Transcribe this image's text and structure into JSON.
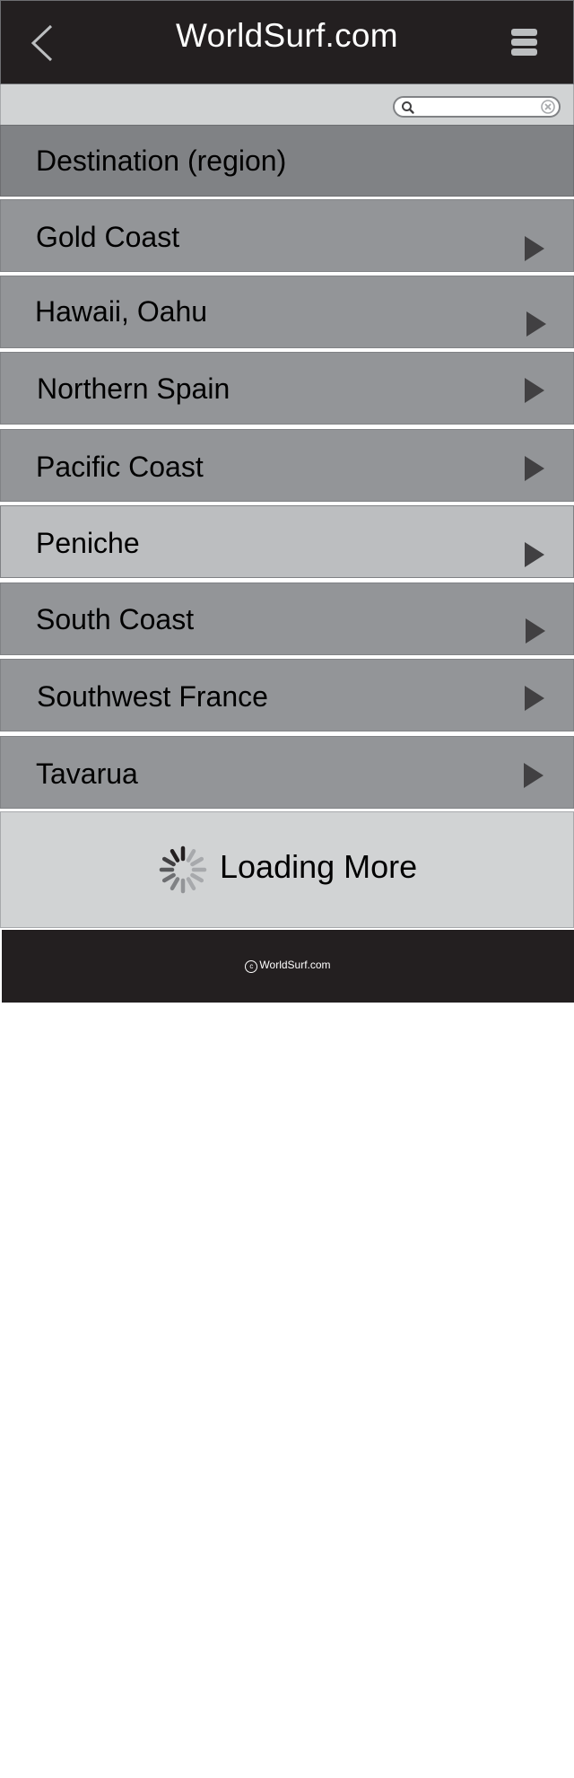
{
  "header": {
    "title": "WorldSurf.com",
    "back_icon": "chevron-left-icon",
    "menu_icon": "hamburger-menu-icon"
  },
  "search": {
    "value": "",
    "placeholder": "",
    "search_icon": "search-icon",
    "clear_icon": "clear-icon"
  },
  "list": {
    "header": "Destination (region)",
    "items": [
      {
        "label": "Gold Coast"
      },
      {
        "label": "Hawaii, Oahu"
      },
      {
        "label": "Northern Spain"
      },
      {
        "label": "Pacific Coast"
      },
      {
        "label": "Peniche",
        "selected": true
      },
      {
        "label": "South Coast"
      },
      {
        "label": "Southwest France"
      },
      {
        "label": "Tavarua"
      }
    ]
  },
  "loading": {
    "label": "Loading More",
    "icon": "spinner-icon"
  },
  "footer": {
    "copyright_symbol": "c",
    "text": "WorldSurf.com"
  },
  "colors": {
    "header_bg": "#231f20",
    "list_header_bg": "#808285",
    "list_item_bg": "#939598",
    "list_item_selected_bg": "#bcbec0",
    "chevron": "#414042",
    "toolbar_bg": "#d1d3d4"
  }
}
